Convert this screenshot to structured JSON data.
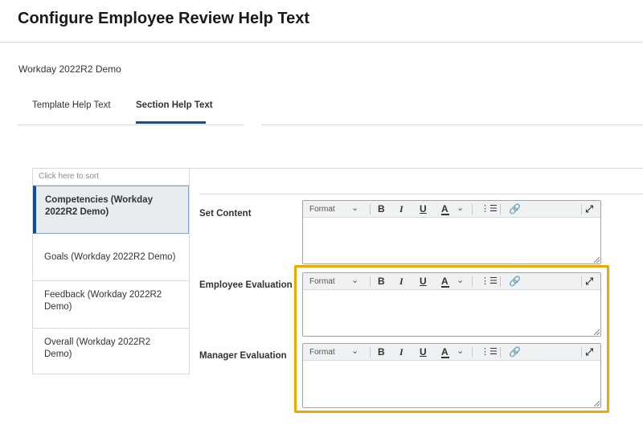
{
  "page": {
    "title": "Configure Employee Review Help Text",
    "tenant": "Workday 2022R2 Demo"
  },
  "tabs": [
    {
      "label": "Template Help Text",
      "active": false
    },
    {
      "label": "Section Help Text",
      "active": true
    }
  ],
  "section_list": {
    "sort_hint": "Click here to sort",
    "items": [
      {
        "label": "Competencies (Workday 2022R2 Demo)",
        "selected": true
      },
      {
        "label": "Goals (Workday 2022R2 Demo)",
        "selected": false
      },
      {
        "label": "Feedback (Workday 2022R2 Demo)",
        "selected": false
      },
      {
        "label": "Overall (Workday 2022R2 Demo)",
        "selected": false
      }
    ]
  },
  "fields": [
    {
      "label": "Set Content",
      "value": ""
    },
    {
      "label": "Employee Evaluation",
      "value": ""
    },
    {
      "label": "Manager Evaluation",
      "value": ""
    }
  ],
  "toolbar": {
    "format_label": "Format",
    "bold_label": "B",
    "italic_label": "I",
    "underline_label": "U",
    "color_label": "A",
    "icons": [
      "chevron-down-icon",
      "bold-icon",
      "italic-icon",
      "underline-icon",
      "text-color-icon",
      "bulleted-list-icon",
      "link-icon",
      "expand-icon"
    ]
  },
  "colors": {
    "accent": "#0b4ea2",
    "highlight": "#f0a800",
    "divider": "#d9dadc"
  }
}
